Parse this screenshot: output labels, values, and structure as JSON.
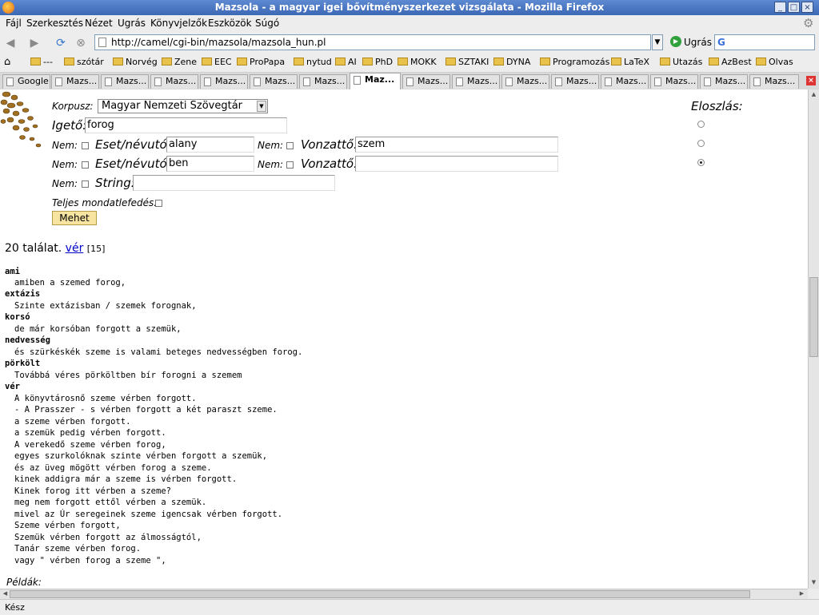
{
  "window": {
    "title": "Mazsola - a magyar igei bővítményszerkezet vizsgálata - Mozilla Firefox"
  },
  "menu": [
    "Fájl",
    "Szerkesztés",
    "Nézet",
    "Ugrás",
    "Könyvjelzők",
    "Eszközök",
    "Súgó"
  ],
  "nav": {
    "url": "http://camel/cgi-bin/mazsola/mazsola_hun.pl",
    "go_label": "Ugrás"
  },
  "bookmarks": [
    "---",
    "szótár",
    "Norvég",
    "Zene",
    "EEC",
    "ProPapa",
    "nytud",
    "AI",
    "PhD",
    "MOKK",
    "SZTAKI",
    "DYNA",
    "Programozás",
    "LaTeX",
    "Utazás",
    "AzBest",
    "Olvas"
  ],
  "tabs": [
    "Google",
    "Mazs...",
    "Mazs...",
    "Mazs...",
    "Mazs...",
    "Mazs...",
    "Mazs...",
    "Maz...",
    "Mazs...",
    "Mazs...",
    "Mazs...",
    "Mazs...",
    "Mazs...",
    "Mazs...",
    "Mazs...",
    "Mazs..."
  ],
  "form": {
    "korpusz_label": "Korpusz:",
    "korpusz_value": "Magyar Nemzeti Szövegtár",
    "igeto_label": "Igető:",
    "igeto_value": "forog",
    "nem_label": "Nem:",
    "eset_label": "Eset/névutó:",
    "vonzatto_label": "Vonzattő:",
    "row1": {
      "eset_value": "alany",
      "vonzatto_value": "szem"
    },
    "row2": {
      "eset_value": "ben",
      "vonzatto_value": ""
    },
    "string_label": "String:",
    "string_value": "",
    "teljes_label": "Teljes mondatlefedés:",
    "submit_label": "Mehet",
    "eloszlas_label": "Eloszlás:"
  },
  "results": {
    "count_text": "20 találat.",
    "link_text": "vér",
    "link_count": "[15]",
    "groups": [
      {
        "key": "ami",
        "lines": [
          "amiben a szemed forog,"
        ]
      },
      {
        "key": "extázis",
        "lines": [
          "Szinte extázisban / szemek forognak,"
        ]
      },
      {
        "key": "korsó",
        "lines": [
          "de már korsóban forgott a szemük,"
        ]
      },
      {
        "key": "nedvesség",
        "lines": [
          "és szürkéskék szeme is valami beteges nedvességben forog."
        ]
      },
      {
        "key": "pörkölt",
        "lines": [
          "Továbbá véres pörköltben bír forogni a szemem"
        ]
      },
      {
        "key": "vér",
        "lines": [
          "A könyvtárosnő szeme vérben forgott.",
          "- A Prasszer - s vérben forgott a két paraszt szeme.",
          "a szeme vérben forgott.",
          "a szemük pedig vérben forgott.",
          "A verekedő szeme vérben forog,",
          "egyes szurkolóknak szinte vérben forgott a szemük,",
          "és az üveg mögött vérben forog a szeme.",
          "kinek addigra már a szeme is vérben forgott.",
          "Kinek forog itt vérben a szeme?",
          "meg nem forgott ettől vérben a szemük.",
          "mivel az Úr seregeinek szeme igencsak vérben forgott.",
          "Szeme vérben forgott,",
          "Szemük vérben forgott az álmosságtól,",
          "Tanár szeme vérben forog.",
          "vagy \" vérben forog a szeme \","
        ]
      }
    ],
    "peldak_label": "Példák:"
  },
  "status": {
    "text": "Kész"
  }
}
